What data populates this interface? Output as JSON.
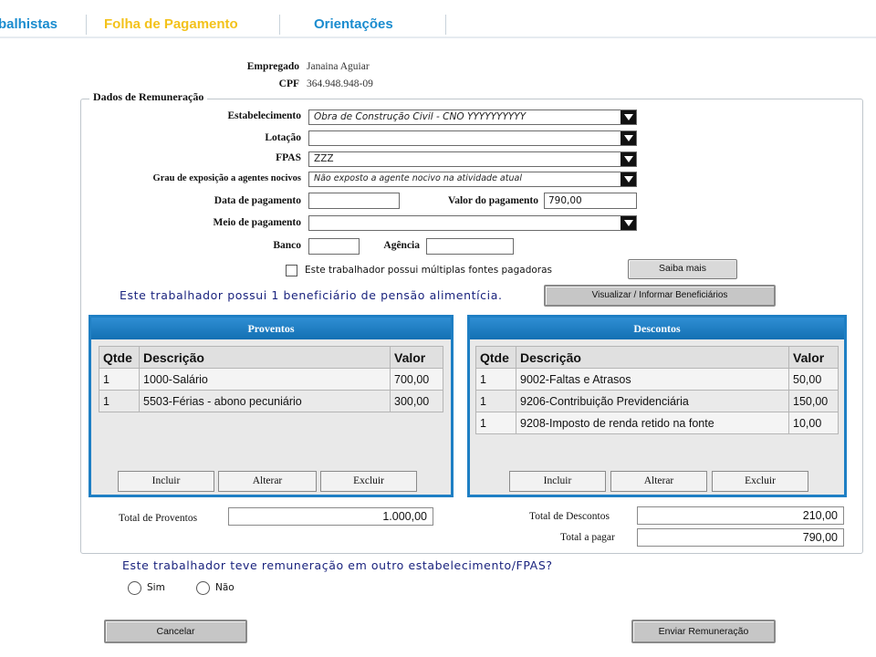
{
  "nav": {
    "tabs": [
      {
        "label": "balhistas",
        "color": "#1a8ccf"
      },
      {
        "label": "Folha de Pagamento",
        "color": "#f3c21b"
      },
      {
        "label": "Orientações",
        "color": "#1a8ccf"
      }
    ]
  },
  "employee": {
    "name_label": "Empregado",
    "name_value": "Janaina Aguiar",
    "cpf_label": "CPF",
    "cpf_value": "364.948.948-09"
  },
  "section": {
    "legend": "Dados de Remuneração"
  },
  "form": {
    "estabelecimento_label": "Estabelecimento",
    "estabelecimento_value": "Obra de Construção Civil - CNO YYYYYYYYYY",
    "lotacao_label": "Lotação",
    "lotacao_value": "",
    "fpas_label": "FPAS",
    "fpas_value": "ZZZ",
    "grau_label": "Grau de exposição a agentes nocivos",
    "grau_value": "Não exposto a agente nocivo na atividade atual",
    "data_pagamento_label": "Data de pagamento",
    "data_pagamento_value": "",
    "valor_pagamento_label": "Valor do pagamento",
    "valor_pagamento_value": "790,00",
    "meio_pagamento_label": "Meio de pagamento",
    "meio_pagamento_value": "",
    "banco_label": "Banco",
    "banco_value": "",
    "agencia_label": "Agência",
    "agencia_value": "",
    "multiplas_fontes_label": "Este trabalhador possui múltiplas fontes pagadoras",
    "multiplas_fontes_checked": false,
    "saiba_mais_label": "Saiba mais",
    "pensao_text": "Este trabalhador possui 1 beneficiário de pensão alimentícia.",
    "visualizar_beneficiarios_label": "Visualizar / Informar Beneficiários"
  },
  "proventos": {
    "title": "Proventos",
    "columns": [
      "Qtde",
      "Descrição",
      "Valor"
    ],
    "rows": [
      {
        "qtde": "1",
        "descricao": "1000-Salário",
        "valor": "700,00"
      },
      {
        "qtde": "1",
        "descricao": "5503-Férias - abono pecuniário",
        "valor": "300,00"
      }
    ],
    "buttons": {
      "incluir": "Incluir",
      "alterar": "Alterar",
      "excluir": "Excluir"
    },
    "total_label": "Total de Proventos",
    "total_value": "1.000,00"
  },
  "descontos": {
    "title": "Descontos",
    "columns": [
      "Qtde",
      "Descrição",
      "Valor"
    ],
    "rows": [
      {
        "qtde": "1",
        "descricao": "9002-Faltas e Atrasos",
        "valor": "50,00"
      },
      {
        "qtde": "1",
        "descricao": "9206-Contribuição Previdenciária",
        "valor": "150,00"
      },
      {
        "qtde": "1",
        "descricao": "9208-Imposto de renda retido na fonte",
        "valor": "10,00"
      }
    ],
    "buttons": {
      "incluir": "Incluir",
      "alterar": "Alterar",
      "excluir": "Excluir"
    },
    "total_label": "Total de Descontos",
    "total_value": "210,00",
    "total_pagar_label": "Total a pagar",
    "total_pagar_value": "790,00"
  },
  "question": {
    "text": "Este trabalhador teve remuneração em outro estabelecimento/FPAS?",
    "options": [
      {
        "label": "Sim",
        "selected": false
      },
      {
        "label": "Não",
        "selected": false
      }
    ]
  },
  "actions": {
    "cancelar_label": "Cancelar",
    "enviar_label": "Enviar Remuneração"
  },
  "colors": {
    "panel_blue": "#1e7fc4",
    "info_text": "#1a237e"
  }
}
